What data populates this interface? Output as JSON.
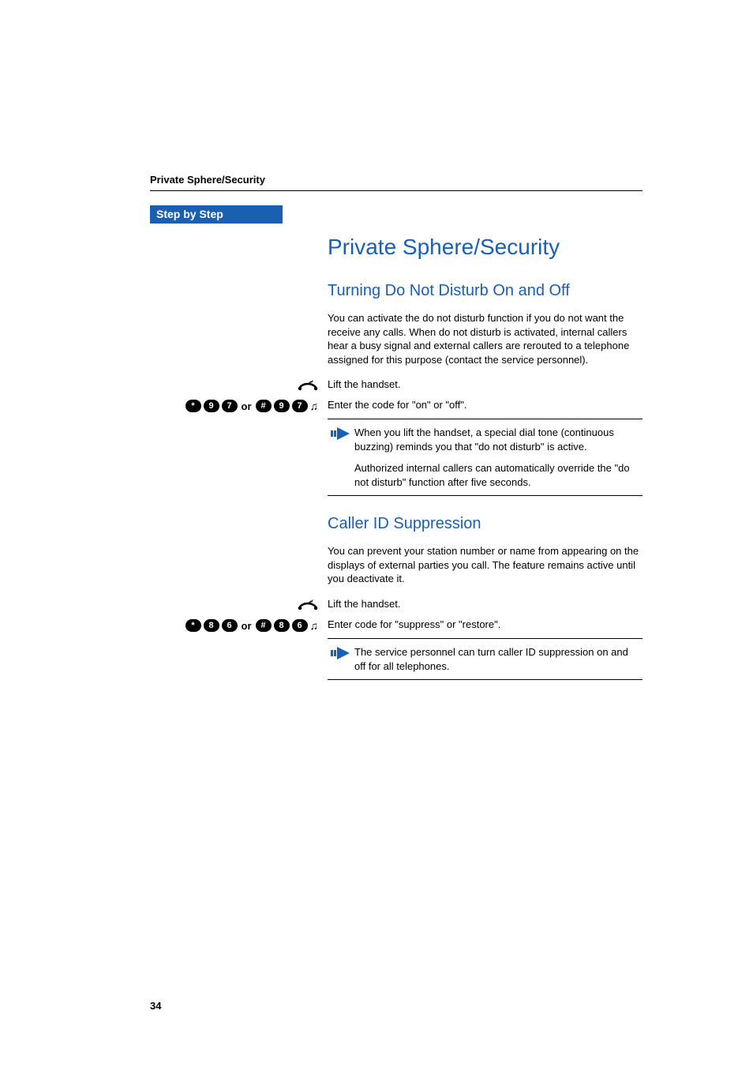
{
  "header": {
    "running_title": "Private Sphere/Security"
  },
  "sidebar": {
    "badge": "Step by Step"
  },
  "title": "Private Sphere/Security",
  "sections": [
    {
      "heading": "Turning Do Not Disturb On and Off",
      "intro": "You can activate the do not disturb function if you do not want the receive any calls. When do not disturb is activated, internal callers hear a busy signal and external callers are rerouted to a telephone assigned for this purpose (contact the service personnel).",
      "steps": [
        {
          "left_type": "handset",
          "text": "Lift the handset."
        },
        {
          "left_type": "code",
          "keys_a": [
            "*",
            "9",
            "7"
          ],
          "or": "or",
          "keys_b": [
            "#",
            "9",
            "7"
          ],
          "tone": true,
          "text": "Enter the code for \"on\" or \"off\"."
        }
      ],
      "note": [
        "When you lift the handset, a special dial tone (continuous buzzing) reminds you that \"do not disturb\" is active.",
        "Authorized internal callers can automatically override the \"do not disturb\" function after five seconds."
      ]
    },
    {
      "heading": "Caller ID Suppression",
      "intro": "You can prevent your station number or name from appearing on the displays of external parties you call. The feature remains active until you deactivate it.",
      "steps": [
        {
          "left_type": "handset",
          "text": "Lift the handset."
        },
        {
          "left_type": "code",
          "keys_a": [
            "*",
            "8",
            "6"
          ],
          "or": "or",
          "keys_b": [
            "#",
            "8",
            "6"
          ],
          "tone": true,
          "text": "Enter code for \"suppress\" or \"restore\"."
        }
      ],
      "note": [
        "The service personnel can turn caller ID suppression on and off for all telephones."
      ]
    }
  ],
  "page_number": "34"
}
